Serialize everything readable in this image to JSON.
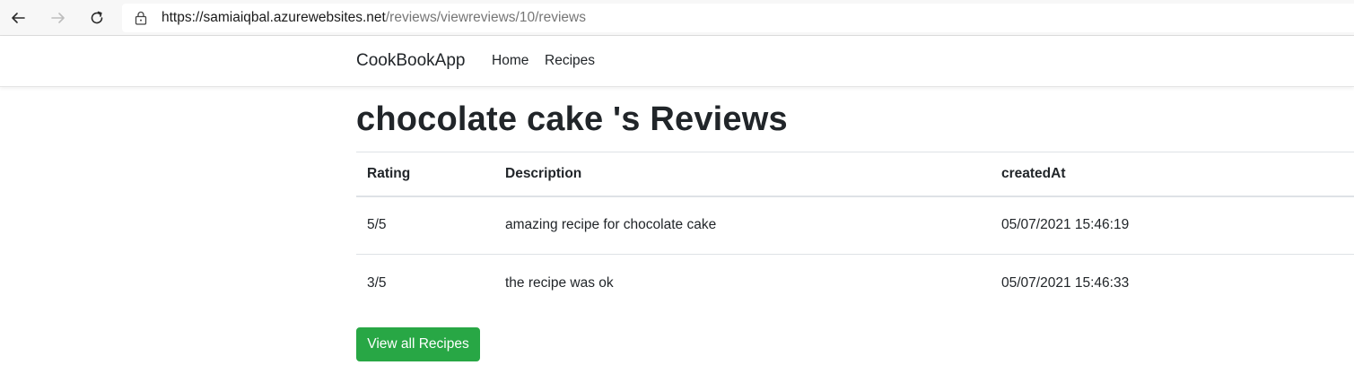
{
  "browser": {
    "url_host": "https://samiaiqbal.azurewebsites.net",
    "url_path": "/reviews/viewreviews/10/reviews"
  },
  "navbar": {
    "brand": "CookBookApp",
    "links": [
      {
        "label": "Home"
      },
      {
        "label": "Recipes"
      }
    ]
  },
  "main": {
    "title": "chocolate cake 's Reviews",
    "table": {
      "headers": [
        "Rating",
        "Description",
        "createdAt"
      ],
      "rows": [
        {
          "rating": "5/5",
          "description": "amazing recipe for chocolate cake",
          "created_at": "05/07/2021 15:46:19"
        },
        {
          "rating": "3/5",
          "description": "the recipe was ok",
          "created_at": "05/07/2021 15:46:33"
        }
      ]
    },
    "view_all_button": "View all Recipes"
  },
  "colors": {
    "button_green": "#28a745",
    "text": "#212529",
    "url_path_gray": "#767676"
  }
}
